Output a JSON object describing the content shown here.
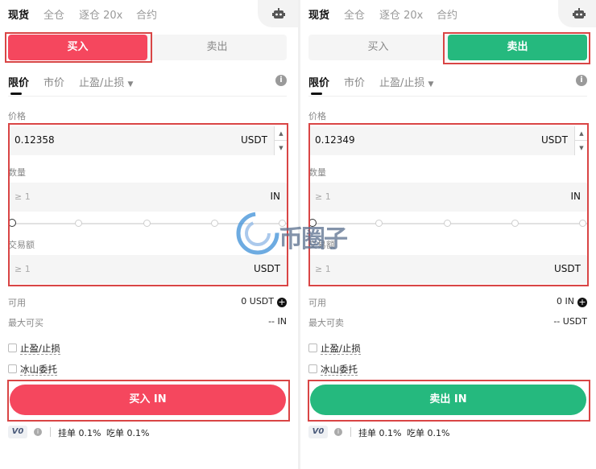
{
  "left": {
    "tabs": [
      "现货",
      "全仓",
      "逐仓 20x",
      "合约"
    ],
    "side_buy": "买入",
    "side_sell": "卖出",
    "order_types": [
      "限价",
      "市价",
      "止盈/止损"
    ],
    "price_label": "价格",
    "price_value": "0.12358",
    "price_unit": "USDT",
    "qty_label": "数量",
    "qty_placeholder": "≥ 1",
    "qty_unit": "IN",
    "amount_label": "交易额",
    "amount_placeholder": "≥ 1",
    "amount_unit": "USDT",
    "available_label": "可用",
    "available_value": "0 USDT",
    "max_label": "最大可买",
    "max_value": "-- IN",
    "chk1": "止盈/止损",
    "chk2": "冰山委托",
    "submit": "买入 IN",
    "vip": "V0",
    "maker_fee": "挂单 0.1%",
    "taker_fee": "吃单 0.1%"
  },
  "right": {
    "tabs": [
      "现货",
      "全仓",
      "逐仓 20x",
      "合约"
    ],
    "side_buy": "买入",
    "side_sell": "卖出",
    "order_types": [
      "限价",
      "市价",
      "止盈/止损"
    ],
    "price_label": "价格",
    "price_value": "0.12349",
    "price_unit": "USDT",
    "qty_label": "数量",
    "qty_placeholder": "≥ 1",
    "qty_unit": "IN",
    "amount_label": "交易额",
    "amount_placeholder": "≥ 1",
    "amount_unit": "USDT",
    "available_label": "可用",
    "available_value": "0 IN",
    "max_label": "最大可卖",
    "max_value": "-- USDT",
    "chk1": "止盈/止损",
    "chk2": "冰山委托",
    "submit": "卖出 IN",
    "vip": "V0",
    "maker_fee": "挂单 0.1%",
    "taker_fee": "吃单 0.1%"
  },
  "watermark_text": "币圈子",
  "colors": {
    "buy": "#f5475e",
    "sell": "#25b97e",
    "highlight": "#d94545"
  }
}
